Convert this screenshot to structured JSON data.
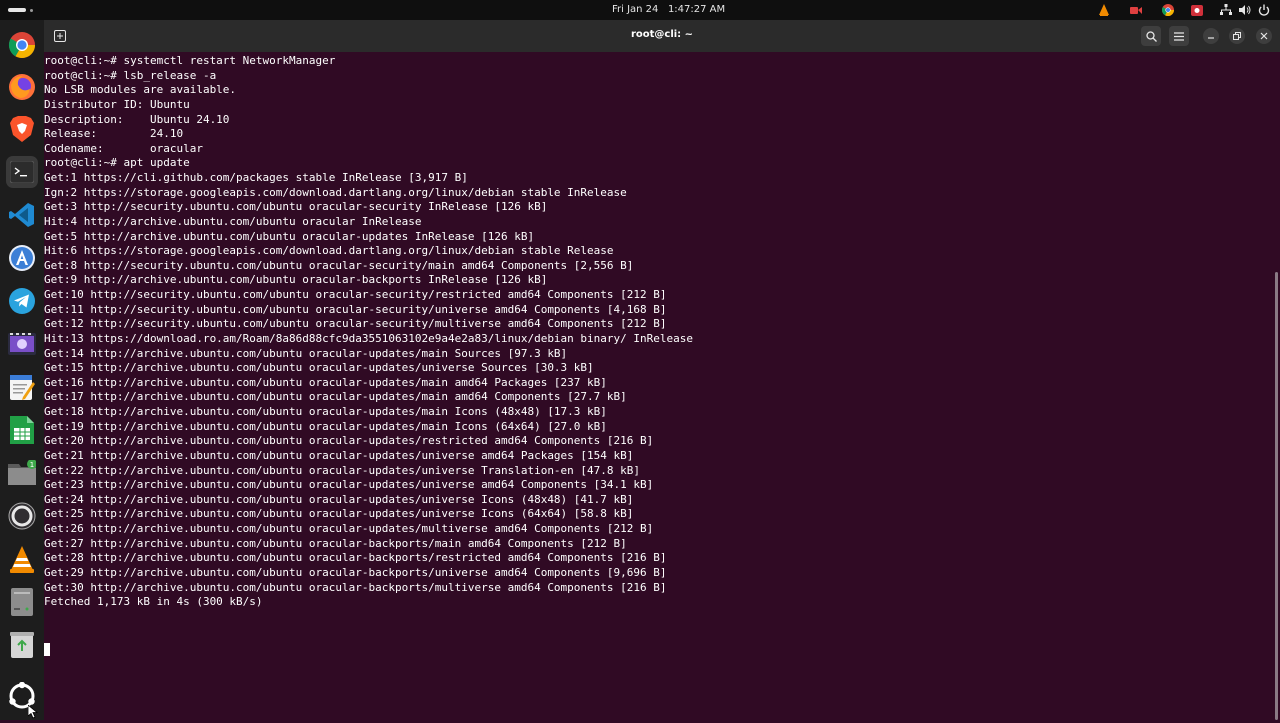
{
  "topbar": {
    "clock": "Fri Jan 24   1:47:27 AM",
    "tray_icons": [
      "vlc-tray-icon",
      "screen-record-icon",
      "chrome-tray-icon",
      "share-icon",
      "network-icon",
      "volume-icon",
      "power-icon"
    ]
  },
  "dock": {
    "apps": [
      "chrome",
      "firefox",
      "brave",
      "terminal",
      "vscode",
      "app-center",
      "telegram",
      "video-editor",
      "text-editor",
      "spreadsheet",
      "files",
      "obs-studio",
      "vlc",
      "disk-utility",
      "trash",
      "show-apps"
    ],
    "files_badge": "1"
  },
  "window": {
    "title": "root@cli: ~"
  },
  "terminal": {
    "lines": [
      "root@cli:~# systemctl restart NetworkManager",
      "root@cli:~# lsb_release -a",
      "No LSB modules are available.",
      "Distributor ID: Ubuntu",
      "Description:    Ubuntu 24.10",
      "Release:        24.10",
      "Codename:       oracular",
      "root@cli:~# apt update",
      "Get:1 https://cli.github.com/packages stable InRelease [3,917 B]",
      "Ign:2 https://storage.googleapis.com/download.dartlang.org/linux/debian stable InRelease",
      "Get:3 http://security.ubuntu.com/ubuntu oracular-security InRelease [126 kB]",
      "Hit:4 http://archive.ubuntu.com/ubuntu oracular InRelease",
      "Get:5 http://archive.ubuntu.com/ubuntu oracular-updates InRelease [126 kB]",
      "Hit:6 https://storage.googleapis.com/download.dartlang.org/linux/debian stable Release",
      "Get:8 http://security.ubuntu.com/ubuntu oracular-security/main amd64 Components [2,556 B]",
      "Get:9 http://archive.ubuntu.com/ubuntu oracular-backports InRelease [126 kB]",
      "Get:10 http://security.ubuntu.com/ubuntu oracular-security/restricted amd64 Components [212 B]",
      "Get:11 http://security.ubuntu.com/ubuntu oracular-security/universe amd64 Components [4,168 B]",
      "Get:12 http://security.ubuntu.com/ubuntu oracular-security/multiverse amd64 Components [212 B]",
      "Hit:13 https://download.ro.am/Roam/8a86d88cfc9da3551063102e9a4e2a83/linux/debian binary/ InRelease",
      "Get:14 http://archive.ubuntu.com/ubuntu oracular-updates/main Sources [97.3 kB]",
      "Get:15 http://archive.ubuntu.com/ubuntu oracular-updates/universe Sources [30.3 kB]",
      "Get:16 http://archive.ubuntu.com/ubuntu oracular-updates/main amd64 Packages [237 kB]",
      "Get:17 http://archive.ubuntu.com/ubuntu oracular-updates/main amd64 Components [27.7 kB]",
      "Get:18 http://archive.ubuntu.com/ubuntu oracular-updates/main Icons (48x48) [17.3 kB]",
      "Get:19 http://archive.ubuntu.com/ubuntu oracular-updates/main Icons (64x64) [27.0 kB]",
      "Get:20 http://archive.ubuntu.com/ubuntu oracular-updates/restricted amd64 Components [216 B]",
      "Get:21 http://archive.ubuntu.com/ubuntu oracular-updates/universe amd64 Packages [154 kB]",
      "Get:22 http://archive.ubuntu.com/ubuntu oracular-updates/universe Translation-en [47.8 kB]",
      "Get:23 http://archive.ubuntu.com/ubuntu oracular-updates/universe amd64 Components [34.1 kB]",
      "Get:24 http://archive.ubuntu.com/ubuntu oracular-updates/universe Icons (48x48) [41.7 kB]",
      "Get:25 http://archive.ubuntu.com/ubuntu oracular-updates/universe Icons (64x64) [58.8 kB]",
      "Get:26 http://archive.ubuntu.com/ubuntu oracular-updates/multiverse amd64 Components [212 B]",
      "Get:27 http://archive.ubuntu.com/ubuntu oracular-backports/main amd64 Components [212 B]",
      "Get:28 http://archive.ubuntu.com/ubuntu oracular-backports/restricted amd64 Components [216 B]",
      "Get:29 http://archive.ubuntu.com/ubuntu oracular-backports/universe amd64 Components [9,696 B]",
      "Get:30 http://archive.ubuntu.com/ubuntu oracular-backports/multiverse amd64 Components [216 B]",
      "Fetched 1,173 kB in 4s (300 kB/s)"
    ]
  },
  "colors": {
    "terminal_bg": "#300a24",
    "topbar_bg": "#0f0f0f",
    "dock_bg": "#1d1d1d",
    "titlebar_bg": "#2b2b2b"
  }
}
